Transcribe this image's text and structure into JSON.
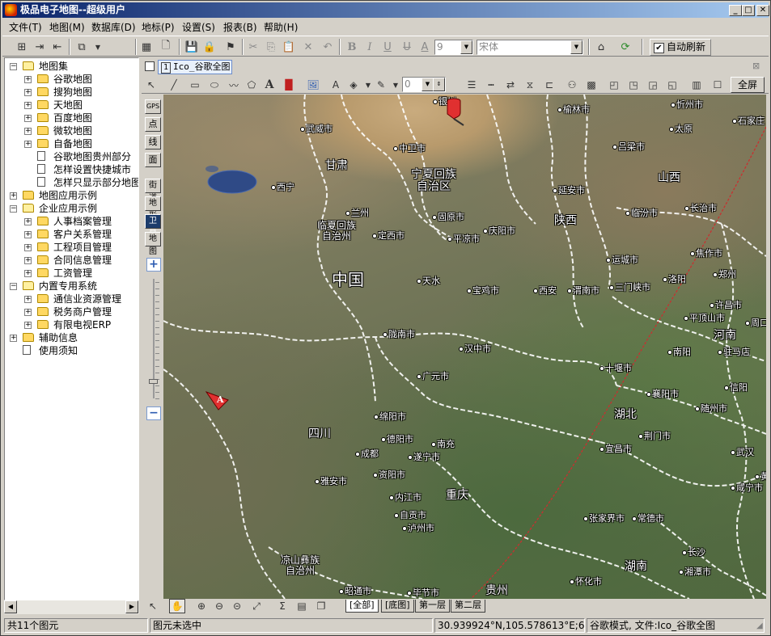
{
  "window": {
    "title": "极品电子地图--超级用户"
  },
  "menu": [
    "文件(T)",
    "地图(M)",
    "数据库(D)",
    "地标(P)",
    "设置(S)",
    "报表(B)",
    "帮助(H)"
  ],
  "toolbar": {
    "font_size_value": "9",
    "font_name_value": "宋体",
    "auto_refresh_label": "自动刷新",
    "auto_refresh_checked": true
  },
  "tree": [
    {
      "label": "地图集",
      "level": 0,
      "type": "folder",
      "expand": "-"
    },
    {
      "label": "谷歌地图",
      "level": 1,
      "type": "folder",
      "expand": "+"
    },
    {
      "label": "搜狗地图",
      "level": 1,
      "type": "folder",
      "expand": "+"
    },
    {
      "label": "天地图",
      "level": 1,
      "type": "folder",
      "expand": "+"
    },
    {
      "label": "百度地图",
      "level": 1,
      "type": "folder",
      "expand": "+"
    },
    {
      "label": "微软地图",
      "level": 1,
      "type": "folder",
      "expand": "+"
    },
    {
      "label": "自备地图",
      "level": 1,
      "type": "folder",
      "expand": "+"
    },
    {
      "label": "谷歌地图贵州部分",
      "level": 1,
      "type": "doc",
      "expand": ""
    },
    {
      "label": "怎样设置快捷城市",
      "level": 1,
      "type": "doc",
      "expand": ""
    },
    {
      "label": "怎样只显示部分地图",
      "level": 1,
      "type": "doc",
      "expand": ""
    },
    {
      "label": "地图应用示例",
      "level": 0,
      "type": "folder",
      "expand": "+"
    },
    {
      "label": "企业应用示例",
      "level": 0,
      "type": "folder",
      "expand": "-"
    },
    {
      "label": "人事档案管理",
      "level": 1,
      "type": "folder",
      "expand": "+"
    },
    {
      "label": "客户关系管理",
      "level": 1,
      "type": "folder",
      "expand": "+"
    },
    {
      "label": "工程项目管理",
      "level": 1,
      "type": "folder",
      "expand": "+"
    },
    {
      "label": "合同信息管理",
      "level": 1,
      "type": "folder",
      "expand": "+"
    },
    {
      "label": "工资管理",
      "level": 1,
      "type": "folder",
      "expand": "+"
    },
    {
      "label": "内置专用系统",
      "level": 0,
      "type": "folder",
      "expand": "-"
    },
    {
      "label": "通信业资源管理",
      "level": 1,
      "type": "folder",
      "expand": "+"
    },
    {
      "label": "税务商户管理",
      "level": 1,
      "type": "folder",
      "expand": "+"
    },
    {
      "label": "有限电视ERP",
      "level": 1,
      "type": "folder",
      "expand": "+"
    },
    {
      "label": "辅助信息",
      "level": 0,
      "type": "folder",
      "expand": "+"
    },
    {
      "label": "使用须知",
      "level": 0,
      "type": "doc",
      "expand": ""
    }
  ],
  "doc_tab": {
    "number": "1",
    "title": "Ico_谷歌全图"
  },
  "draw_toolbar": {
    "line_width_value": "0",
    "fullscreen_label": "全屏"
  },
  "map_tools": {
    "gps": "GPS",
    "point": "点",
    "line": "线",
    "area": "面",
    "street": "街道",
    "terrain": "地形",
    "satellite": "卫星",
    "map": "地图",
    "zoom_in": "+",
    "zoom_out": "−"
  },
  "map": {
    "provinces": [
      {
        "text": "甘肃"
      },
      {
        "text": "宁夏回族\n自治区"
      },
      {
        "text": "山西"
      },
      {
        "text": "陕西"
      },
      {
        "text": "中国"
      },
      {
        "text": "河南"
      },
      {
        "text": "四川"
      },
      {
        "text": "湖北"
      },
      {
        "text": "重庆"
      },
      {
        "text": "湖南"
      },
      {
        "text": "贵州"
      },
      {
        "text": "临夏回族\n自治州"
      },
      {
        "text": "凉山彝族\n自治州"
      }
    ],
    "cities": [
      "银川",
      "榆林市",
      "忻州市",
      "石家庄",
      "武威市",
      "中卫市",
      "太原",
      "吕梁市",
      "西宁",
      "延安市",
      "兰州",
      "临汾市",
      "长治市",
      "固原市",
      "庆阳市",
      "定西市",
      "平凉市",
      "运城市",
      "焦作市",
      "郑州",
      "天水",
      "洛阳",
      "宝鸡市",
      "西安",
      "渭南市",
      "三门峡市",
      "许昌市",
      "平顶山市",
      "周口",
      "陇南市",
      "汉中市",
      "南阳",
      "驻马店",
      "十堰市",
      "广元市",
      "襄阳市",
      "信阳",
      "绵阳市",
      "随州市",
      "德阳市",
      "南充",
      "荆门市",
      "成都",
      "遂宁市",
      "宜昌市",
      "武汉",
      "资阳市",
      "雅安市",
      "咸宁市",
      "黄",
      "内江市",
      "张家界市",
      "常德市",
      "自贡市",
      "泸州市",
      "长沙",
      "湘潭市",
      "昭通市",
      "毕节市",
      "怀化市"
    ],
    "marker_letter": "A"
  },
  "layer_tabs": [
    "[全部]",
    "[底图]",
    "第一层",
    "第二层"
  ],
  "status": {
    "count": "共11个图元",
    "selection": "图元未选中",
    "coords": "30.939924°N,105.578613°E;6级",
    "mode": "谷歌模式, 文件:Ico_谷歌全图"
  }
}
